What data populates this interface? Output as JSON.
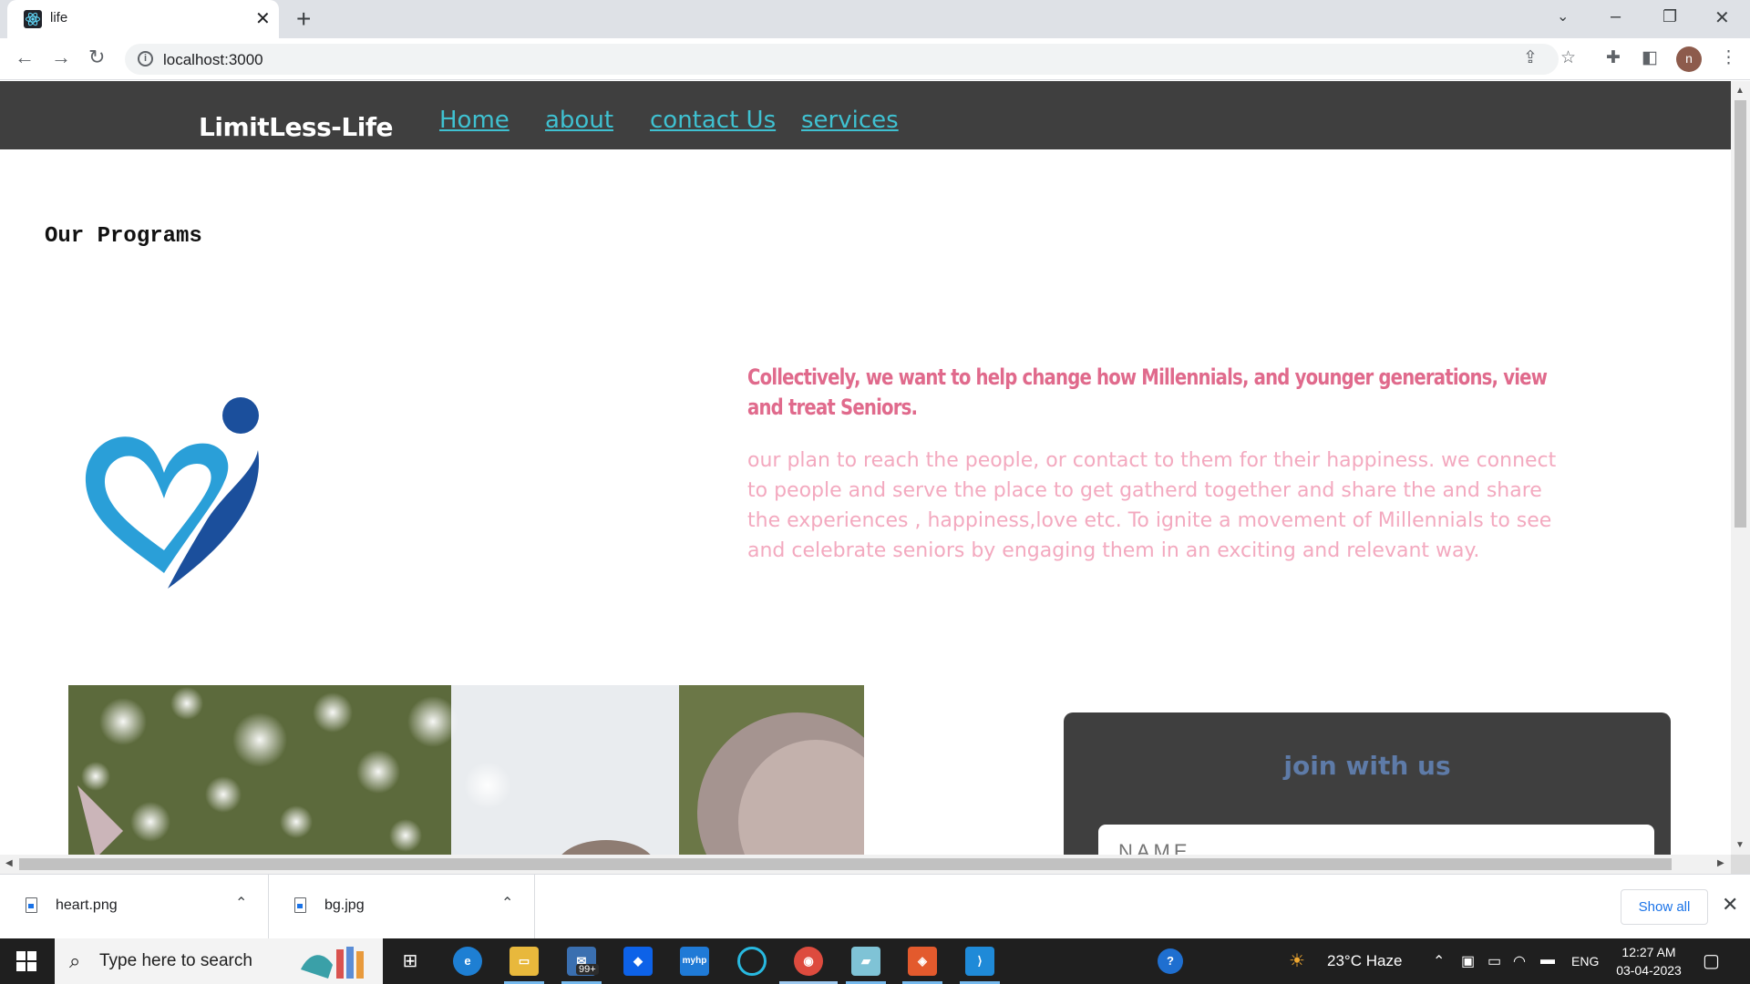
{
  "browser": {
    "tab_title": "life",
    "url": "localhost:3000",
    "profile_initial": "n"
  },
  "site": {
    "brand": "LimitLess-Life",
    "nav": [
      "Home",
      "about",
      "contact Us",
      "services"
    ],
    "section_title": "Our Programs",
    "headline": "Collectively, we want to help change how Millennials, and younger generations, view and treat Seniors.",
    "description": "our plan to reach the people, or contact to them for their happiness. we connect to people and serve the place to get gatherd together and share the and share the experiences , happiness,love etc. To ignite a movement of Millennials to see and celebrate seniors by engaging them in an exciting and relevant way.",
    "join": {
      "title": "join with us",
      "name_placeholder": "NAME"
    },
    "colors": {
      "nav_bg": "#3f3f3f",
      "link": "#3fc1d1",
      "headline": "#e06a8c",
      "description": "#f3a9bf",
      "join_title": "#5e7ba8"
    }
  },
  "downloads": {
    "items": [
      {
        "name": "heart.png",
        "icon": "file-icon"
      },
      {
        "name": "bg.jpg",
        "icon": "file-icon"
      }
    ],
    "show_all": "Show all"
  },
  "taskbar": {
    "search_placeholder": "Type here to search",
    "mail_badge": "99+",
    "weather": "23°C  Haze",
    "language": "ENG",
    "time": "12:27 AM",
    "date": "03-04-2023"
  }
}
